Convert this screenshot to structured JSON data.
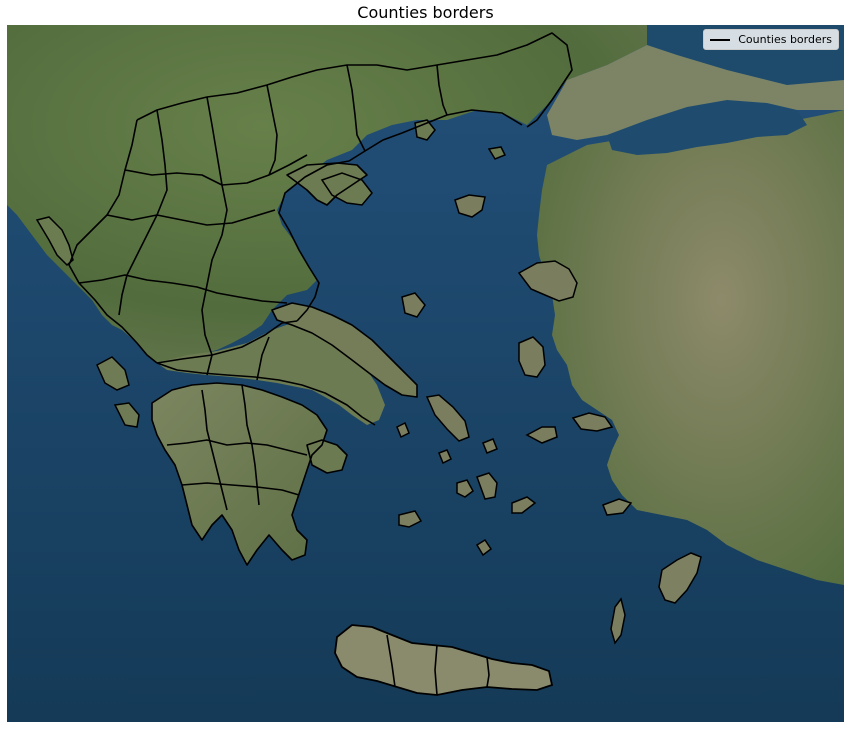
{
  "title": "Counties borders",
  "legend": {
    "label": "Counties borders",
    "line_color": "#000000"
  },
  "colors": {
    "sea": "#1c4565",
    "sea_deep": "#143a57",
    "land_green": "#566f3f",
    "land_light": "#8c8c6e",
    "border": "#000000"
  }
}
